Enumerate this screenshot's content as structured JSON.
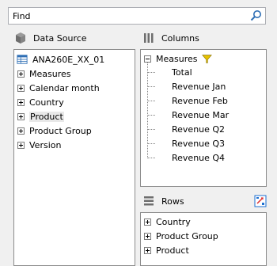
{
  "search": {
    "value": "Find"
  },
  "data_source": {
    "header": "Data Source",
    "root": "ANA260E_XX_01",
    "items": [
      "Measures",
      "Calendar month",
      "Country",
      "Product",
      "Product Group",
      "Version"
    ],
    "selected": "Product"
  },
  "columns": {
    "header": "Columns",
    "group": "Measures",
    "items": [
      "Total",
      "Revenue Jan",
      "Revenue Feb",
      "Revenue Mar",
      "Revenue Q2",
      "Revenue Q3",
      "Revenue Q4"
    ]
  },
  "rows": {
    "header": "Rows",
    "items": [
      "Country",
      "Product Group",
      "Product"
    ]
  },
  "colors": {
    "filter_icon": "#e6c200",
    "selected_row": "#e8e8e8",
    "accent": "#1e6fd0"
  }
}
